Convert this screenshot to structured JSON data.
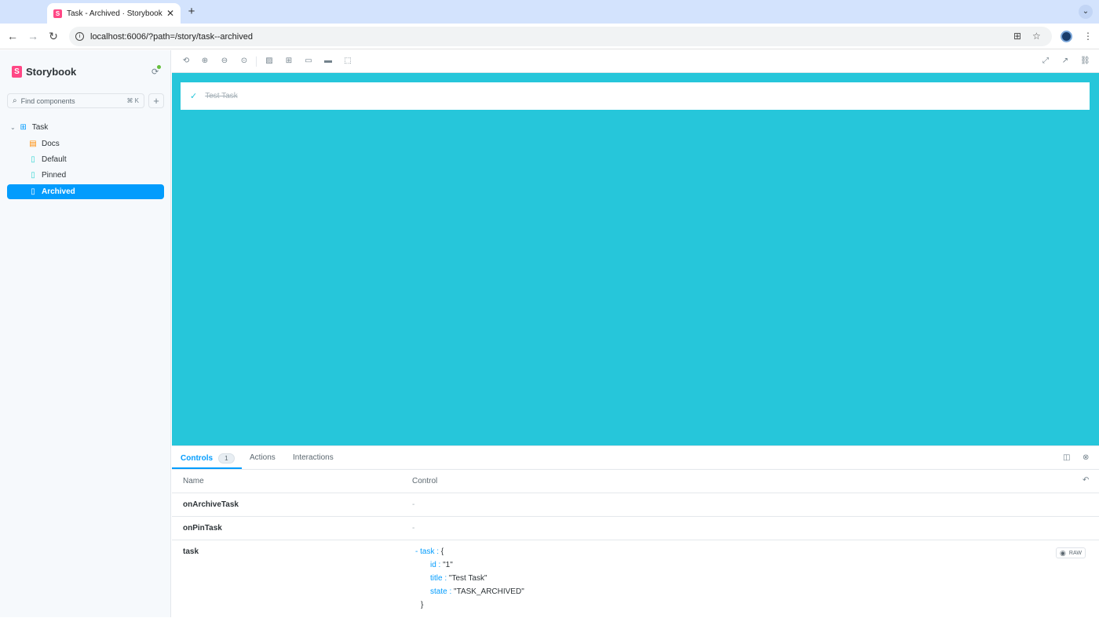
{
  "browser": {
    "tab_title": "Task - Archived · Storybook",
    "tab_close": "✕",
    "new_tab": "+",
    "url": "localhost:6006/?path=/story/task--archived"
  },
  "sidebar": {
    "brand": "Storybook",
    "search_placeholder": "Find components",
    "search_shortcut": "⌘ K",
    "add_label": "+",
    "items": [
      {
        "label": "Task",
        "icon": "component-icon"
      },
      {
        "label": "Docs",
        "icon": "document-icon"
      },
      {
        "label": "Default",
        "icon": "bookmark-icon"
      },
      {
        "label": "Pinned",
        "icon": "bookmark-icon"
      },
      {
        "label": "Archived",
        "icon": "bookmark-icon",
        "active": true
      }
    ]
  },
  "preview": {
    "background": "#26c6da",
    "task_title": "Test Task"
  },
  "panel": {
    "tabs": [
      {
        "label": "Controls",
        "badge": "1",
        "active": true
      },
      {
        "label": "Actions"
      },
      {
        "label": "Interactions"
      }
    ],
    "headers": {
      "name": "Name",
      "control": "Control"
    },
    "rows": [
      {
        "name": "onArchiveTask",
        "control": "-"
      },
      {
        "name": "onPinTask",
        "control": "-"
      }
    ],
    "task_row": {
      "name": "task",
      "toggle": "- task :",
      "open_brace": "{",
      "fields": [
        {
          "key": "id :",
          "value": "\"1\""
        },
        {
          "key": "title :",
          "value": "\"Test Task\""
        },
        {
          "key": "state :",
          "value": "\"TASK_ARCHIVED\""
        }
      ],
      "close_brace": "}",
      "raw_label": "RAW"
    }
  },
  "colors": {
    "accent": "#029cfd",
    "brand": "#ff4785",
    "preview_bg": "#26c6da"
  }
}
